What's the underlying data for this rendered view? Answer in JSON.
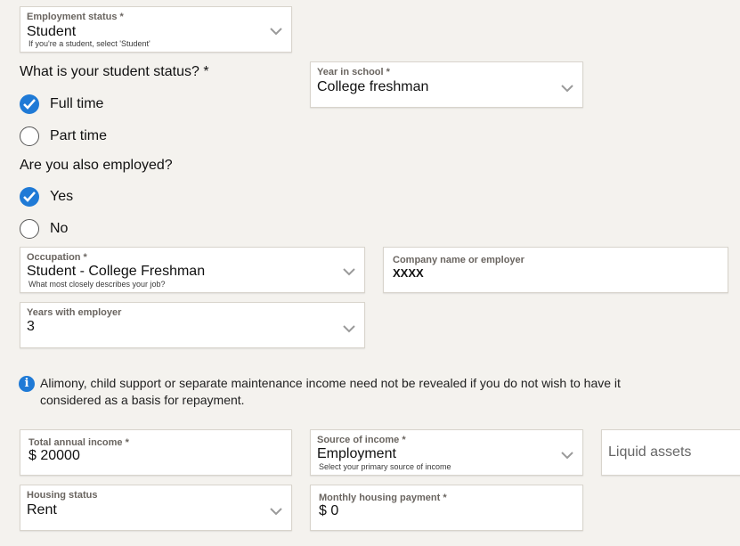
{
  "employment_status": {
    "label": "Employment status *",
    "value": "Student",
    "help": "If you're a student, select 'Student'"
  },
  "student_status": {
    "question": "What is your student status? *",
    "options": [
      {
        "label": "Full time",
        "checked": true
      },
      {
        "label": "Part time",
        "checked": false
      }
    ]
  },
  "year_in_school": {
    "label": "Year in school *",
    "value": "College freshman"
  },
  "also_employed": {
    "question": "Are you also employed?",
    "options": [
      {
        "label": "Yes",
        "checked": true
      },
      {
        "label": "No",
        "checked": false
      }
    ]
  },
  "occupation": {
    "label": "Occupation *",
    "value": "Student - College Freshman",
    "help": "What most closely describes your job?"
  },
  "company": {
    "label": "Company name or employer",
    "value": "XXXX"
  },
  "years_with_employer": {
    "label": "Years with employer",
    "value": "3"
  },
  "notice": {
    "icon": "info-icon",
    "text": "Alimony, child support or separate maintenance income need not be revealed if you do not wish to have it considered as a basis for repayment."
  },
  "total_income": {
    "label": "Total annual income *",
    "value": "$ 20000"
  },
  "income_source": {
    "label": "Source of income *",
    "value": "Employment",
    "help": "Select your primary source of income"
  },
  "liquid_assets": {
    "placeholder": "Liquid assets"
  },
  "housing_status": {
    "label": "Housing status",
    "value": "Rent"
  },
  "housing_payment": {
    "label": "Monthly housing payment *",
    "value": "$ 0"
  },
  "colors": {
    "accent": "#1f7ad6",
    "background": "#f4f2ee"
  }
}
